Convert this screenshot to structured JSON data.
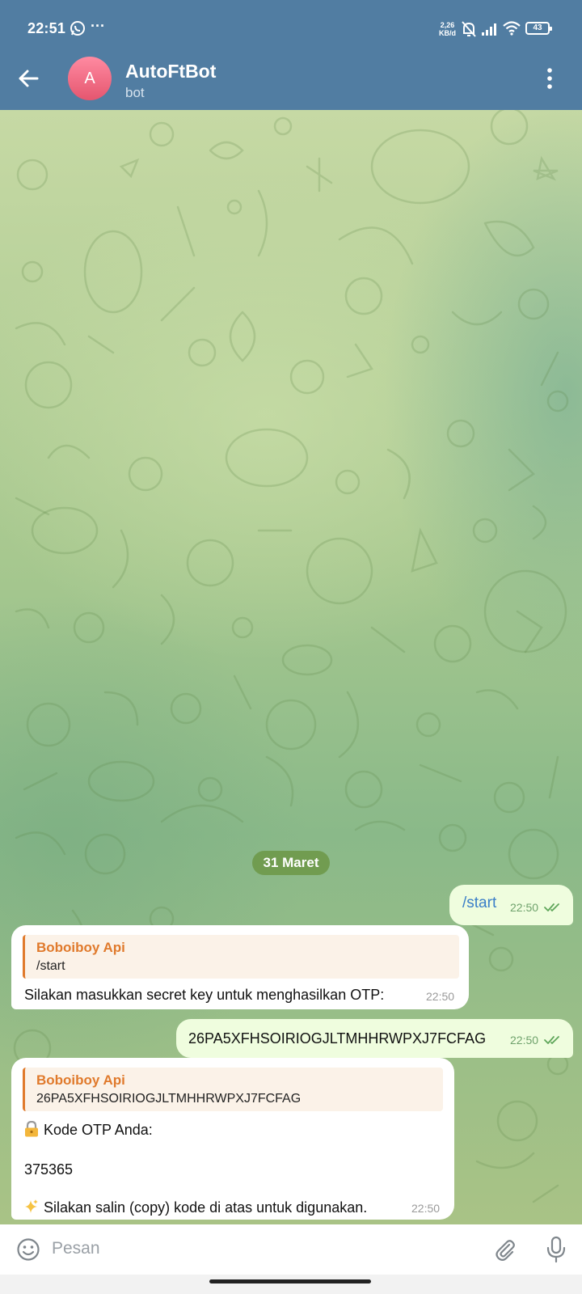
{
  "status_bar": {
    "time": "22:51",
    "overflow": "···",
    "speed_value": "2,26",
    "speed_unit": "KB/d",
    "battery": "43"
  },
  "header": {
    "avatar_letter": "A",
    "title": "AutoFtBot",
    "subtitle": "bot"
  },
  "chat": {
    "date_chip": "31 Maret",
    "messages": [
      {
        "direction": "out",
        "text": "/start",
        "time": "22:50",
        "read": true
      },
      {
        "direction": "in",
        "reply_name": "Boboiboy Api",
        "reply_text": "/start",
        "text": "Silakan masukkan secret key untuk menghasilkan OTP:",
        "time": "22:50"
      },
      {
        "direction": "out",
        "text": "26PA5XFHSOIRIOGJLTMHHRWPXJ7FCFAG",
        "time": "22:50",
        "read": true
      },
      {
        "direction": "in",
        "reply_name": "Boboiboy Api",
        "reply_text": "26PA5XFHSOIRIOGJLTMHHRWPXJ7FCFAG",
        "line1": "Kode OTP Anda:",
        "line2": "375365",
        "line3": "Silakan salin (copy) kode di atas untuk digunakan.",
        "time": "22:50"
      }
    ]
  },
  "composer": {
    "placeholder": "Pesan"
  },
  "colors": {
    "header": "#517da2",
    "outgoing_bubble": "#effdde",
    "incoming_bubble": "#ffffff",
    "reply_accent": "#e07a2c",
    "date_chip": "#6c9646"
  },
  "icons": [
    "back-arrow-icon",
    "more-vert-icon",
    "double-check-icon",
    "lock-icon",
    "sparkles-icon",
    "emoji-icon",
    "attach-icon",
    "mic-icon",
    "whatsapp-icon",
    "mute-icon",
    "signal-icon",
    "wifi-icon",
    "battery-icon"
  ]
}
